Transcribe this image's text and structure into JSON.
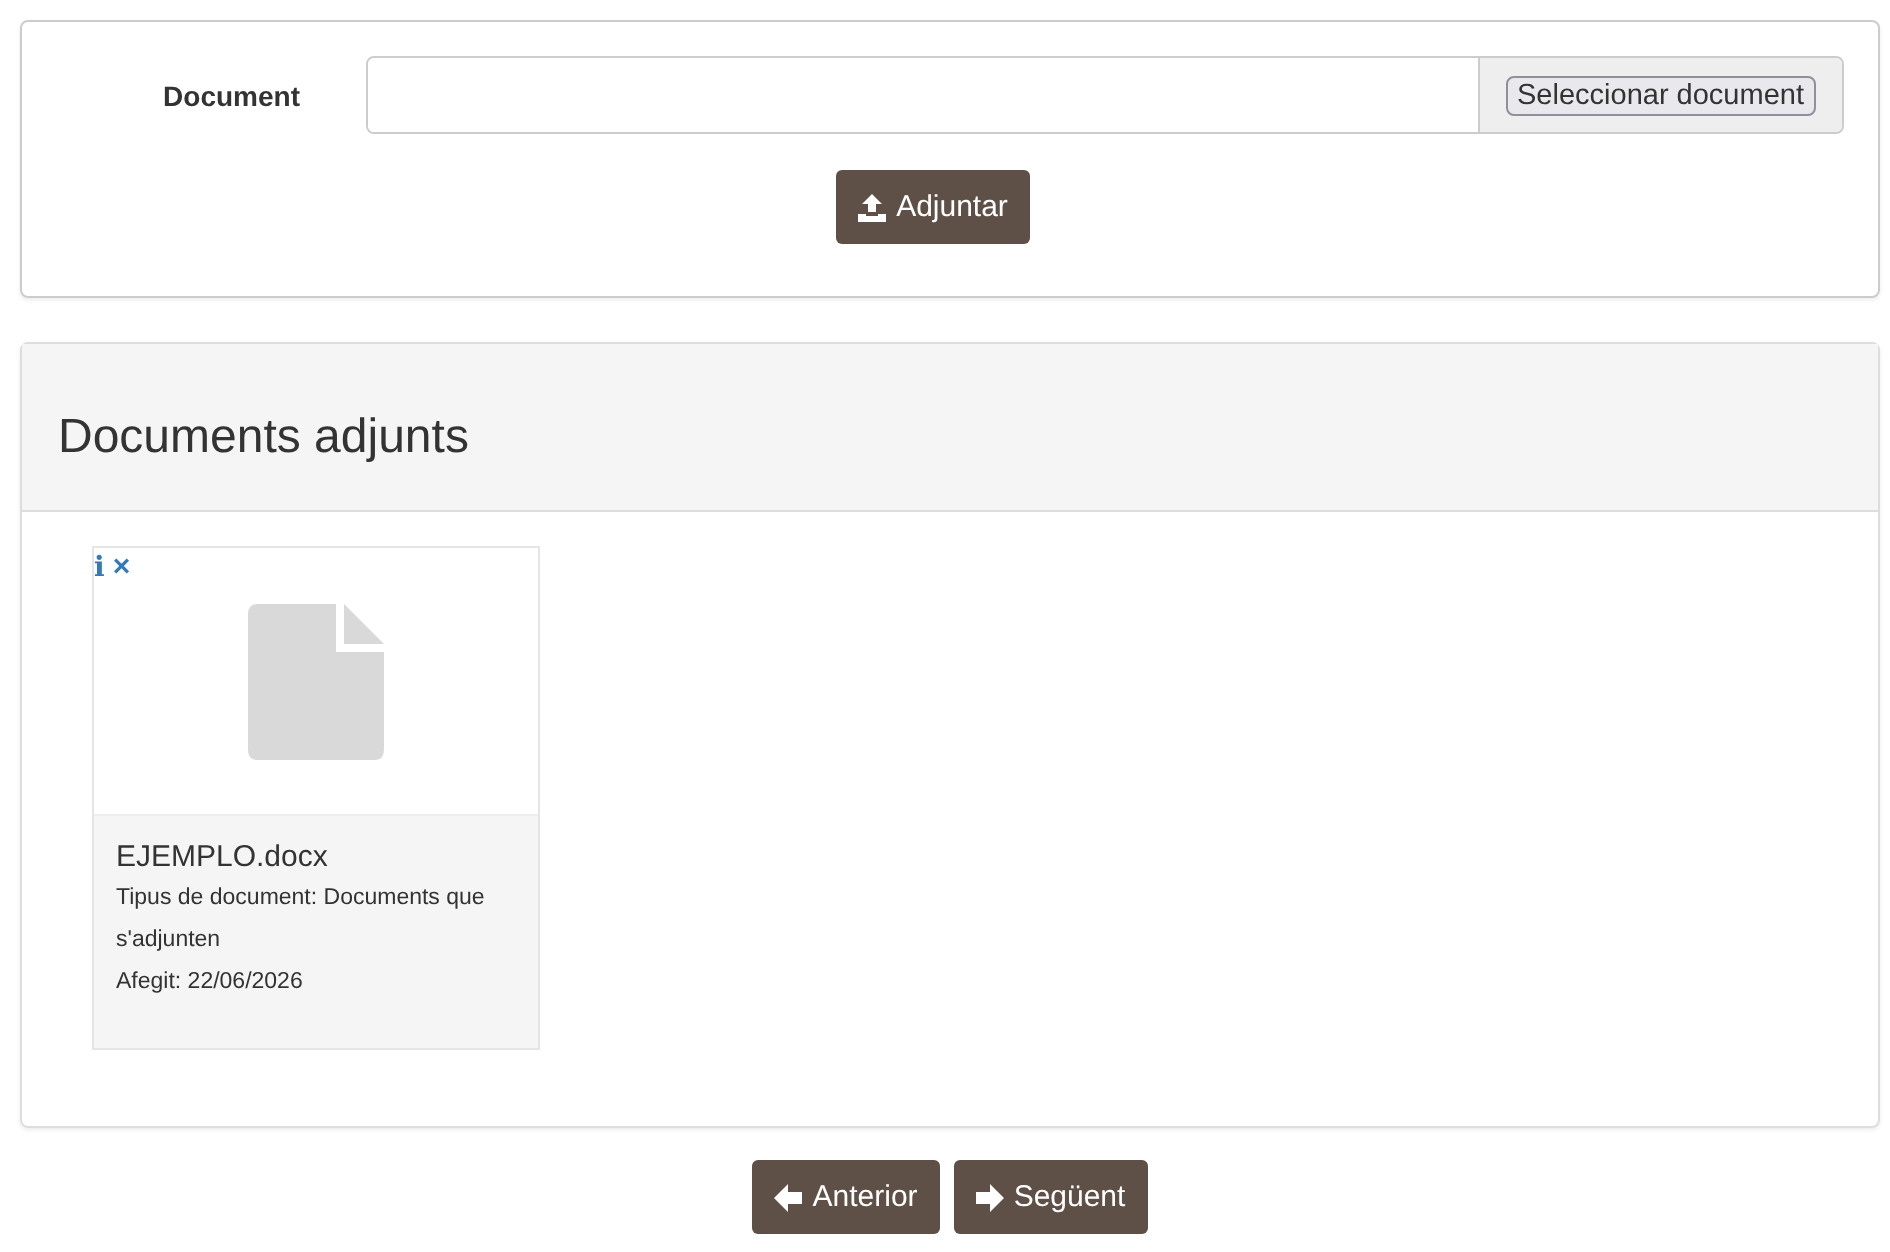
{
  "upload": {
    "label": "Document",
    "browse_button": "Seleccionar document",
    "attach_button": "Adjuntar"
  },
  "attachments": {
    "title": "Documents adjunts",
    "items": [
      {
        "info_icon": "i",
        "remove_icon": "×",
        "name": "EJEMPLO.docx",
        "type": "Tipus de document: Documents que s'adjunten",
        "added": "Afegit: 22/06/2026"
      }
    ]
  },
  "navigation": {
    "buttons": [
      {
        "kind": "prev",
        "label": "Anterior"
      },
      {
        "kind": "next",
        "label": "Següent"
      }
    ]
  }
}
